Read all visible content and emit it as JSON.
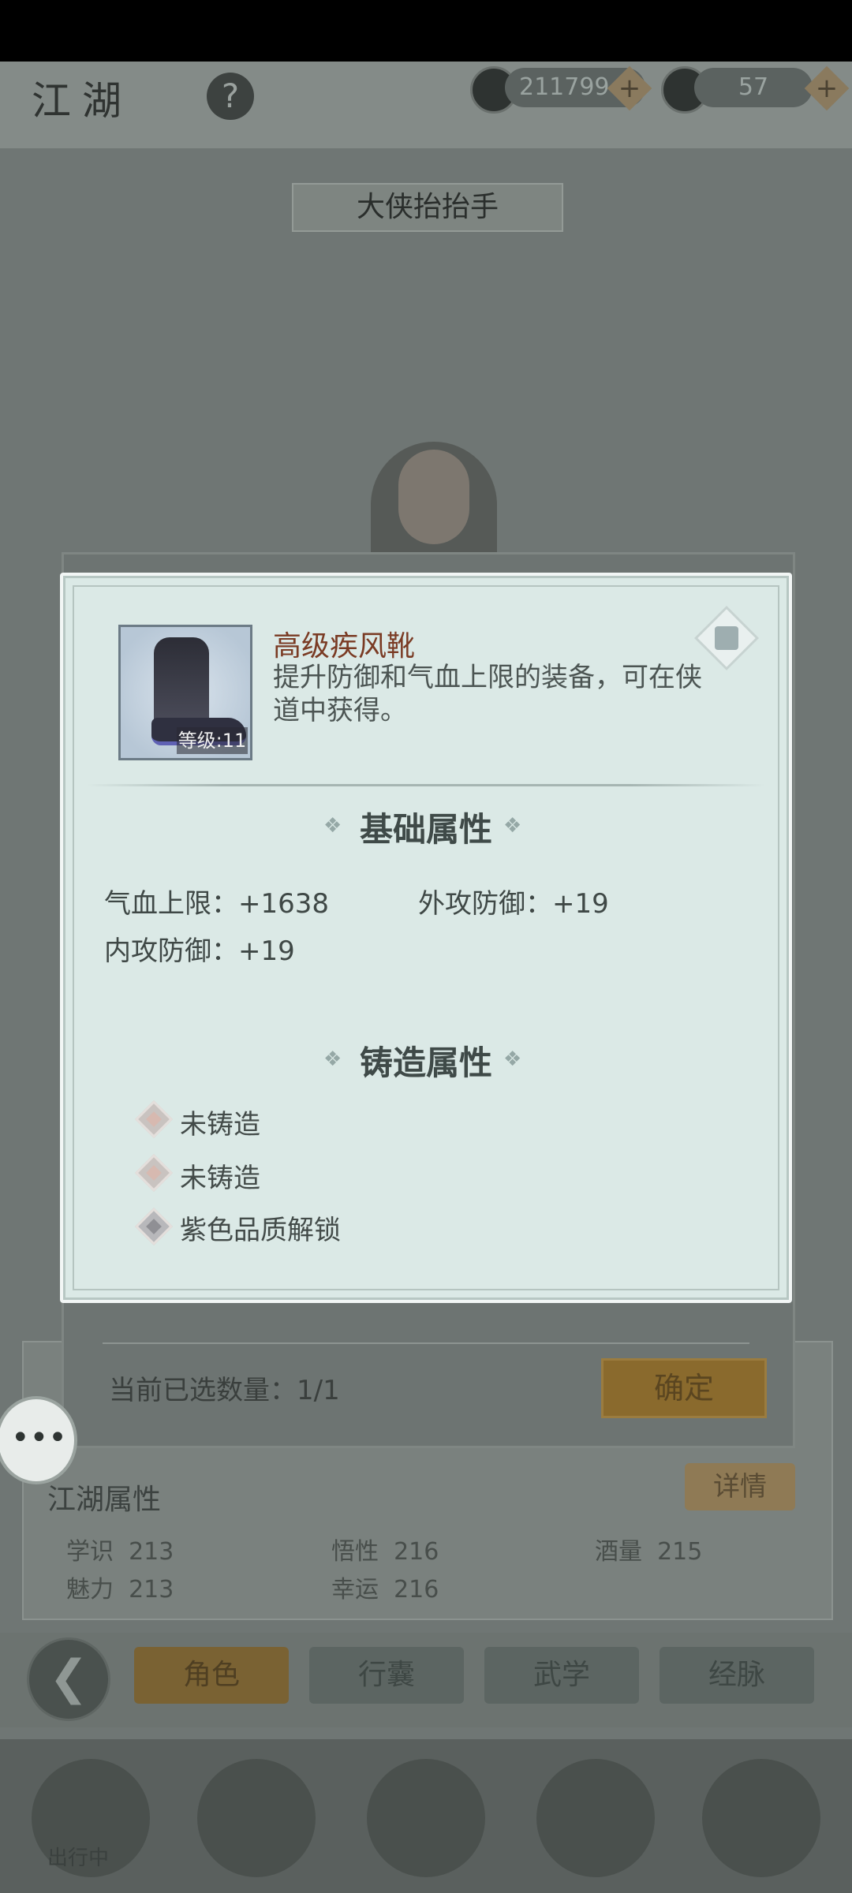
{
  "header": {
    "title": "江湖",
    "help_symbol": "?",
    "coins": "211799",
    "ingots": "57",
    "plus_symbol": "+",
    "banner": "大侠抬抬手"
  },
  "background_panel": {
    "jianghu_attr_title": "江湖属性",
    "detail_button": "详情",
    "attributes": [
      {
        "label": "学识",
        "value": "213"
      },
      {
        "label": "悟性",
        "value": "216"
      },
      {
        "label": "酒量",
        "value": "215"
      },
      {
        "label": "魅力",
        "value": "213"
      },
      {
        "label": "幸运",
        "value": "216"
      }
    ]
  },
  "tabs": [
    {
      "label": "角色",
      "active": true
    },
    {
      "label": "行囊",
      "active": false
    },
    {
      "label": "武学",
      "active": false
    },
    {
      "label": "经脉",
      "active": false
    }
  ],
  "dock": {
    "center_label": "出行中"
  },
  "selection": {
    "count_label": "当前已选数量：1/1",
    "confirm_label": "确定"
  },
  "item": {
    "name": "高级疾风靴",
    "description": "提升防御和气血上限的装备，可在侠道中获得。",
    "level_badge": "等级:11",
    "base_section_title": "基础属性",
    "base_stats": [
      {
        "label": "气血上限",
        "value": "+1638"
      },
      {
        "label": "外攻防御",
        "value": "+19"
      },
      {
        "label": "内攻防御",
        "value": "+19"
      }
    ],
    "forge_section_title": "铸造属性",
    "forge_slots": [
      {
        "text": "未铸造",
        "locked": false
      },
      {
        "text": "未铸造",
        "locked": false
      },
      {
        "text": "紫色品质解锁",
        "locked": true
      }
    ]
  },
  "colors": {
    "item_name": "#7a3b24",
    "dialog_bg": "#dbe9e6",
    "confirm_button": "#8a6a2d"
  }
}
